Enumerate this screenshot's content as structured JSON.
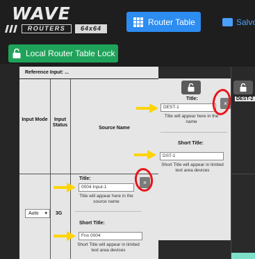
{
  "header": {
    "logo": {
      "brand": "WAVE",
      "sub": "ROUTERS",
      "size": "64x64"
    },
    "router_table_button": "Router Table",
    "save_button": "Salvo"
  },
  "lock_button": "Local Router Table Lock",
  "table": {
    "reference_label": "Reference Input: ...",
    "columns": {
      "input_mode": "Input Mode",
      "input_status": "Input Status",
      "source_name": "Source Name"
    },
    "dest1": {
      "title_label": "Title:",
      "title_value": "DEST-1",
      "title_help": "Title will appear here in the name",
      "short_title_label": "Short Title:",
      "short_title_value": "DST-1",
      "short_title_help": "Short Title will appear in limited text area devices"
    },
    "dest2_label": "DEST-2",
    "row1": {
      "mode_value": "Auto",
      "status": "3G",
      "title_label": "Title:",
      "title_value": "0004 Input-1",
      "title_help": "Title will appear here in the source name",
      "short_title_label": "Short Title:",
      "short_title_value": "Fnn 0004",
      "short_title_help": "Short Title will appear in limited text area devices"
    },
    "close_glyph": "×"
  },
  "colors": {
    "accent_blue": "#2d8cf0",
    "lock_green": "#1fa35a",
    "highlight_red": "#e8141a",
    "arrow_yellow": "#ffd400"
  }
}
